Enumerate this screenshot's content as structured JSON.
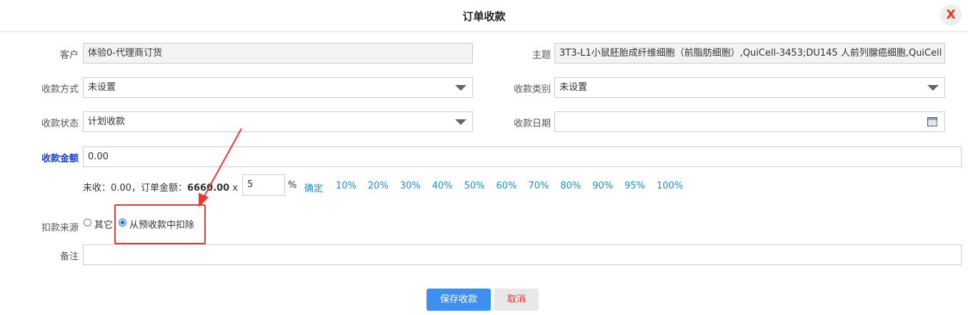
{
  "dialog": {
    "title": "订单收款",
    "close_label": "X"
  },
  "form": {
    "customer": {
      "label": "客户",
      "value": "体验0-代理商订货"
    },
    "subject": {
      "label": "主题",
      "value": "3T3-L1小鼠胚胎成纤维细胞（前脂肪细胞）,QuiCell-3453;DU145 人前列腺癌细胞,QuiCell"
    },
    "pay_method": {
      "label": "收款方式",
      "value": "未设置"
    },
    "pay_category": {
      "label": "收款类别",
      "value": "未设置"
    },
    "pay_status": {
      "label": "收款状态",
      "value": "计划收款"
    },
    "pay_date": {
      "label": "收款日期",
      "value": ""
    },
    "amount": {
      "label": "收款金额",
      "value": "0.00"
    },
    "summary": {
      "unpaid_text": "未收：0.00，订单金额：",
      "order_amount": "6660.00",
      "times": "x",
      "percent_value": "5",
      "percent_sign": "%",
      "confirm_label": "确定",
      "percents": [
        "10%",
        "20%",
        "30%",
        "40%",
        "50%",
        "60%",
        "70%",
        "80%",
        "90%",
        "95%",
        "100%"
      ]
    },
    "deduct_source": {
      "label": "扣款来源",
      "options": [
        {
          "label": "其它",
          "selected": false
        },
        {
          "label": "从预收款中扣除",
          "selected": true
        }
      ]
    },
    "remark": {
      "label": "备注",
      "value": ""
    }
  },
  "buttons": {
    "save_label": "保存收款",
    "cancel_label": "取消"
  },
  "colors": {
    "highlight": "#e53935",
    "primary": "#3f8ff0",
    "link": "#1b8fc4",
    "amount_label": "#1a3fcf"
  }
}
